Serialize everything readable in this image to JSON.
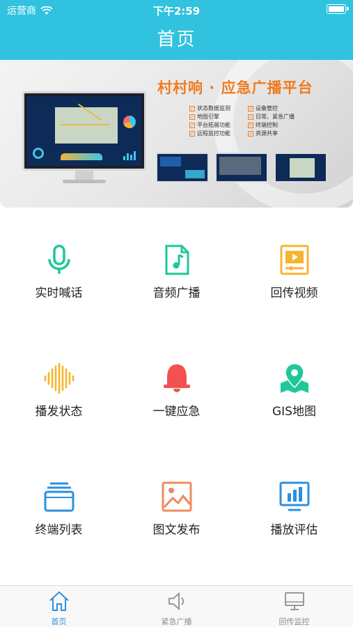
{
  "status_bar": {
    "carrier": "运营商",
    "time": "下午2:59"
  },
  "header": {
    "title": "首页"
  },
  "banner": {
    "title": "村村响 · 应急广播平台",
    "features": [
      "状态数据监测",
      "设备管控",
      "地图引擎",
      "日常、紧急广播",
      "平台拓展功能",
      "终端控制",
      "远程监控功能",
      "资源共享"
    ]
  },
  "grid": [
    {
      "label": "实时喊话",
      "icon": "microphone-icon",
      "color": "#1fc79a"
    },
    {
      "label": "音频广播",
      "icon": "music-file-icon",
      "color": "#1fc79a"
    },
    {
      "label": "回传视频",
      "icon": "video-player-icon",
      "color": "#f5b52e"
    },
    {
      "label": "播发状态",
      "icon": "sound-wave-icon",
      "color": "#f5b52e"
    },
    {
      "label": "一键应急",
      "icon": "alarm-bell-icon",
      "color": "#f2524f"
    },
    {
      "label": "GIS地图",
      "icon": "map-pin-icon",
      "color": "#1fc79a"
    },
    {
      "label": "终端列表",
      "icon": "folder-stack-icon",
      "color": "#2d8fe0"
    },
    {
      "label": "图文发布",
      "icon": "image-icon",
      "color": "#f08a5d"
    },
    {
      "label": "播放评估",
      "icon": "bar-chart-monitor-icon",
      "color": "#2d8fe0"
    }
  ],
  "tabs": [
    {
      "label": "首页",
      "icon": "home-icon",
      "active": true
    },
    {
      "label": "紧急广播",
      "icon": "speaker-icon",
      "active": false
    },
    {
      "label": "回传监控",
      "icon": "monitor-icon",
      "active": false
    }
  ],
  "colors": {
    "header": "#31c2e0",
    "active_tab": "#2d8fe0",
    "banner_title": "#f07b1f"
  }
}
